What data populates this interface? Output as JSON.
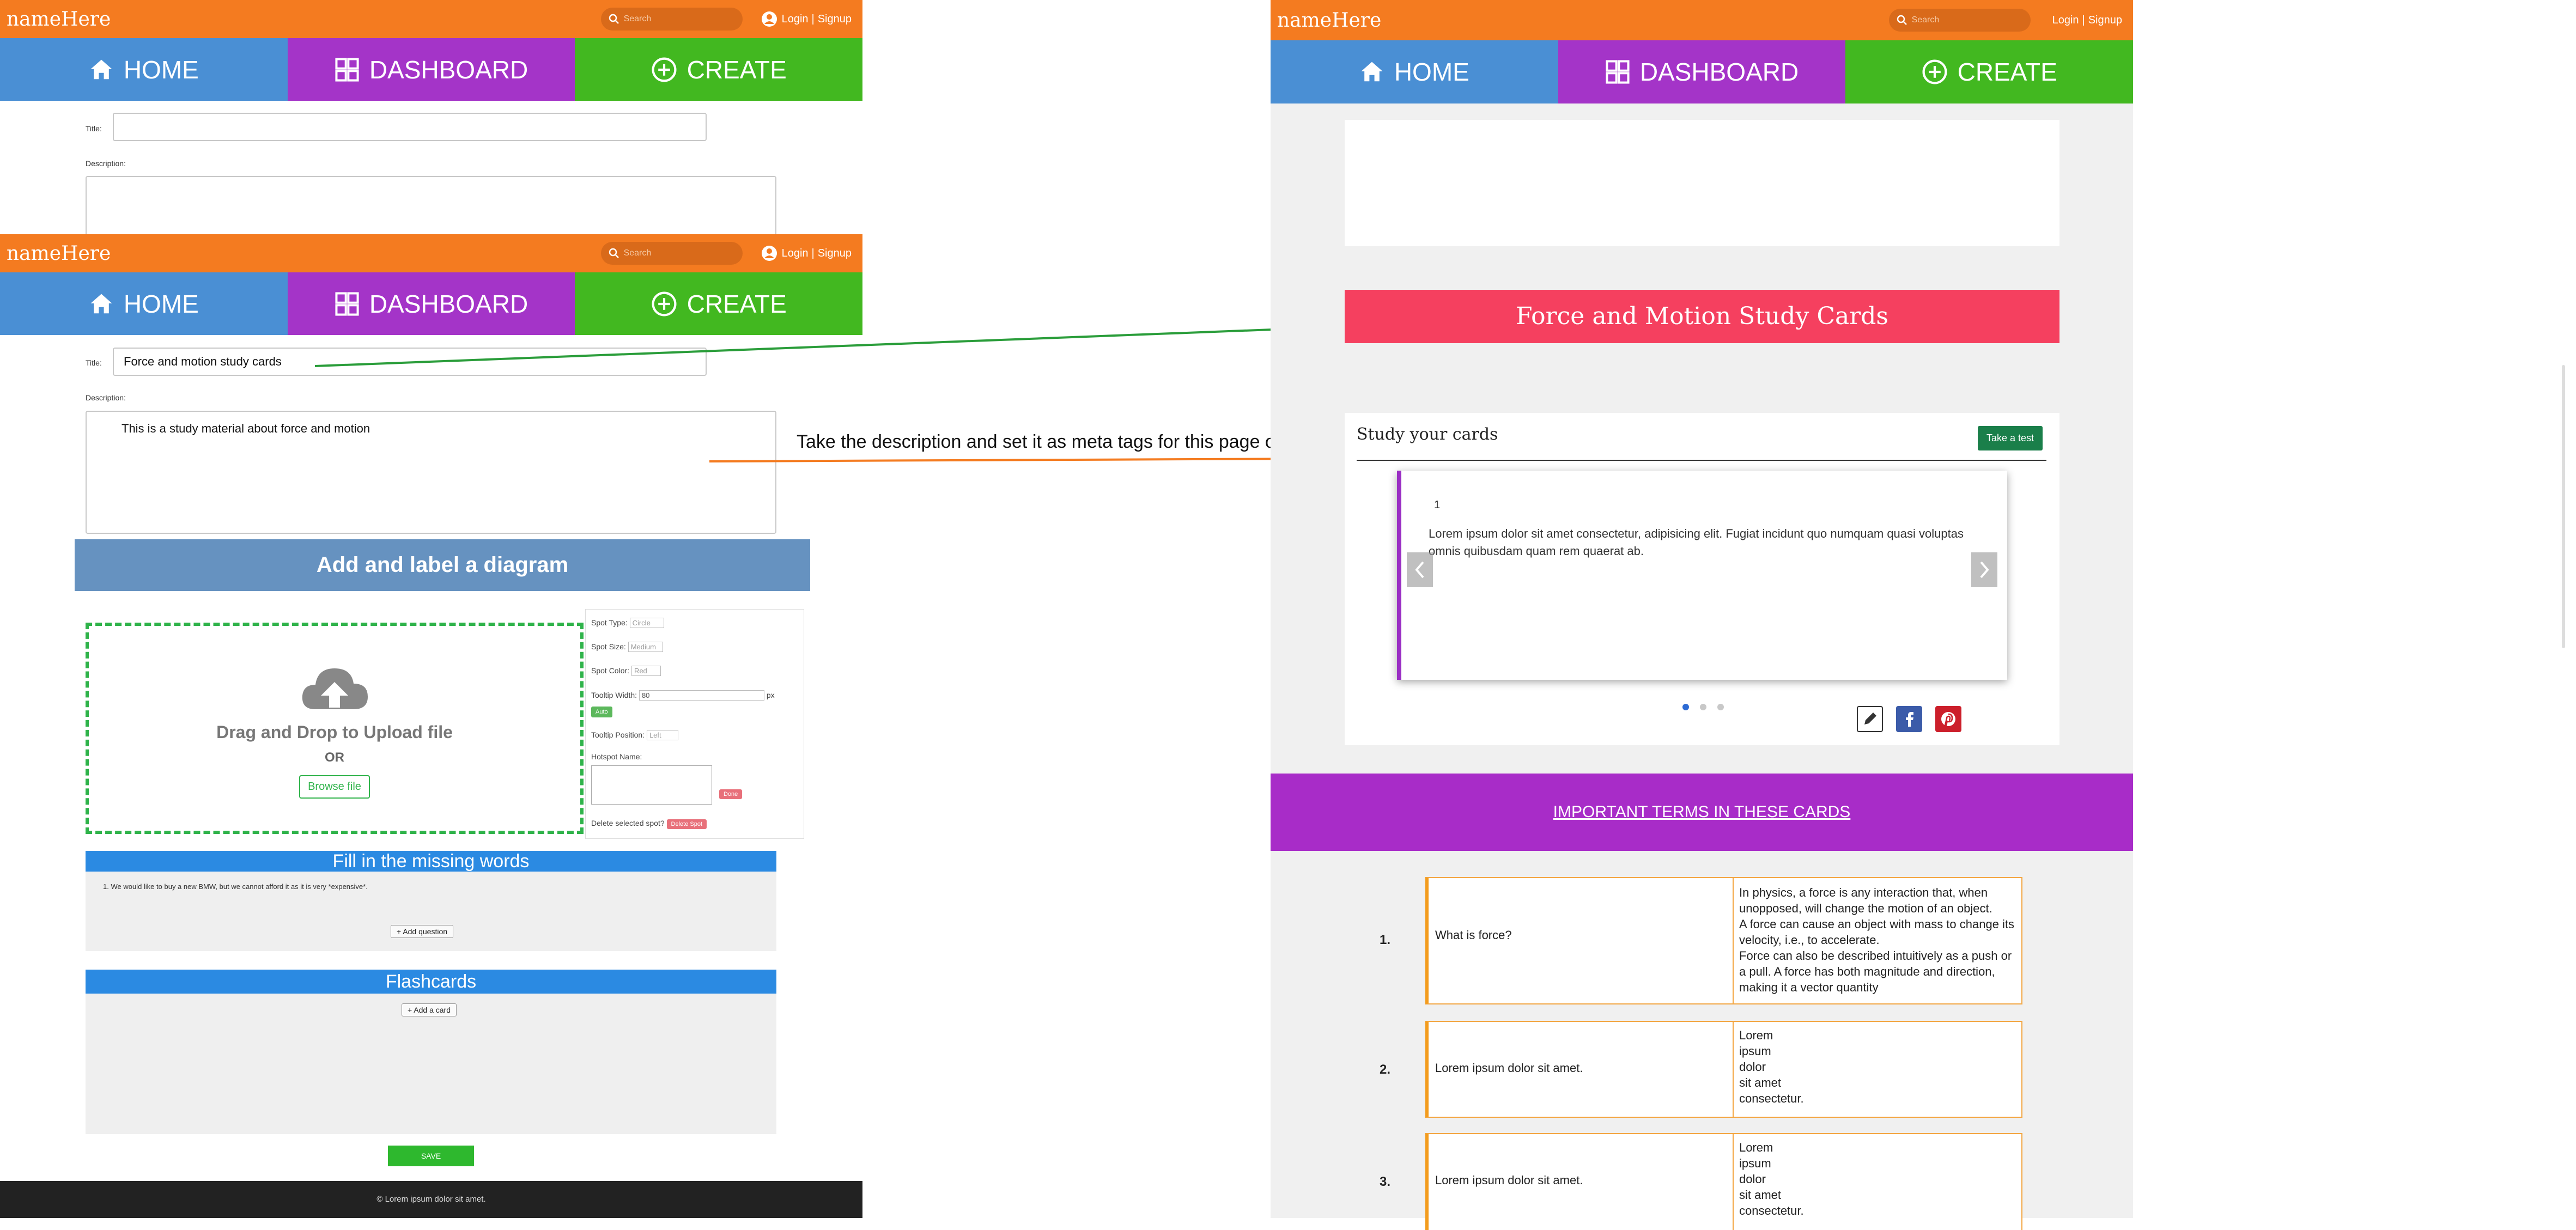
{
  "app": {
    "brand": "nameHere",
    "search_placeholder": "Search",
    "login": "Login",
    "sep": "|",
    "signup": "Signup"
  },
  "nav": {
    "home": "HOME",
    "dashboard": "DASHBOARD",
    "create": "CREATE"
  },
  "form_top": {
    "title_label": "Title:",
    "description_label": "Description:"
  },
  "form": {
    "title_label": "Title:",
    "title_value": "Force and motion study cards",
    "description_label": "Description:",
    "description_value": "This is a study material about force and motion"
  },
  "diagram": {
    "header": "Add and label a diagram",
    "drop_text": "Drag and Drop to Upload file",
    "or": "OR",
    "browse": "Browse file",
    "spot_type_label": "Spot Type:",
    "spot_type_value": "Circle",
    "spot_size_label": "Spot Size:",
    "spot_size_value": "Medium",
    "spot_color_label": "Spot Color:",
    "spot_color_value": "Red",
    "tooltip_width_label": "Tooltip Width:",
    "tooltip_width_value": "80",
    "px": "px",
    "auto": "Auto",
    "tooltip_pos_label": "Tooltip Position:",
    "tooltip_pos_value": "Left",
    "hotspot_name_label": "Hotspot Name:",
    "done": "Done",
    "delete_label": "Delete selected spot?",
    "delete_btn": "Delete Spot"
  },
  "missing_words": {
    "header": "Fill in the missing words",
    "item": "1. We would like to buy a new BMW, but we cannot afford it as it is very *expensive*.",
    "add_question": "+ Add question"
  },
  "flashcards": {
    "header": "Flashcards",
    "add_card": "+ Add a card"
  },
  "save": "SAVE",
  "footer": "© Lorem ipsum dolor sit amet.",
  "annotation": "Take the description and set it as meta tags for this page on the right",
  "preview": {
    "title": "Force and Motion Study Cards",
    "study_heading": "Study your cards",
    "take_test": "Take a test",
    "card_number": "1",
    "card_text": "Lorem ipsum dolor sit amet consectetur, adipisicing elit. Fugiat incidunt quo numquam quasi voluptas omnis quibusdam quam rem quaerat ab.",
    "terms_heading": "IMPORTANT TERMS IN THESE CARDS",
    "terms": [
      {
        "num": "1.",
        "term": "What is force?",
        "definition": [
          "In physics, a force is any interaction that, when",
          "unopposed, will change the motion of an object.",
          "A force can cause an object with mass to change its",
          "velocity, i.e., to accelerate.",
          "Force can also be described intuitively as a push or",
          "a pull. A force has both magnitude and direction,",
          "making it a vector quantity"
        ]
      },
      {
        "num": "2.",
        "term": "Lorem ipsum dolor sit amet.",
        "definition": [
          "Lorem",
          "ipsum",
          "dolor",
          "sit amet",
          "consectetur."
        ]
      },
      {
        "num": "3.",
        "term": "Lorem ipsum dolor sit amet.",
        "definition": [
          "Lorem",
          "ipsum",
          "dolor",
          "sit amet",
          "consectetur."
        ]
      }
    ]
  },
  "colors": {
    "orange": "#f47b20",
    "blue": "#4a8fd4",
    "purple": "#a434c8",
    "green": "#42b820",
    "title_red": "#f5405f",
    "terms_purple": "#a82cc8"
  }
}
